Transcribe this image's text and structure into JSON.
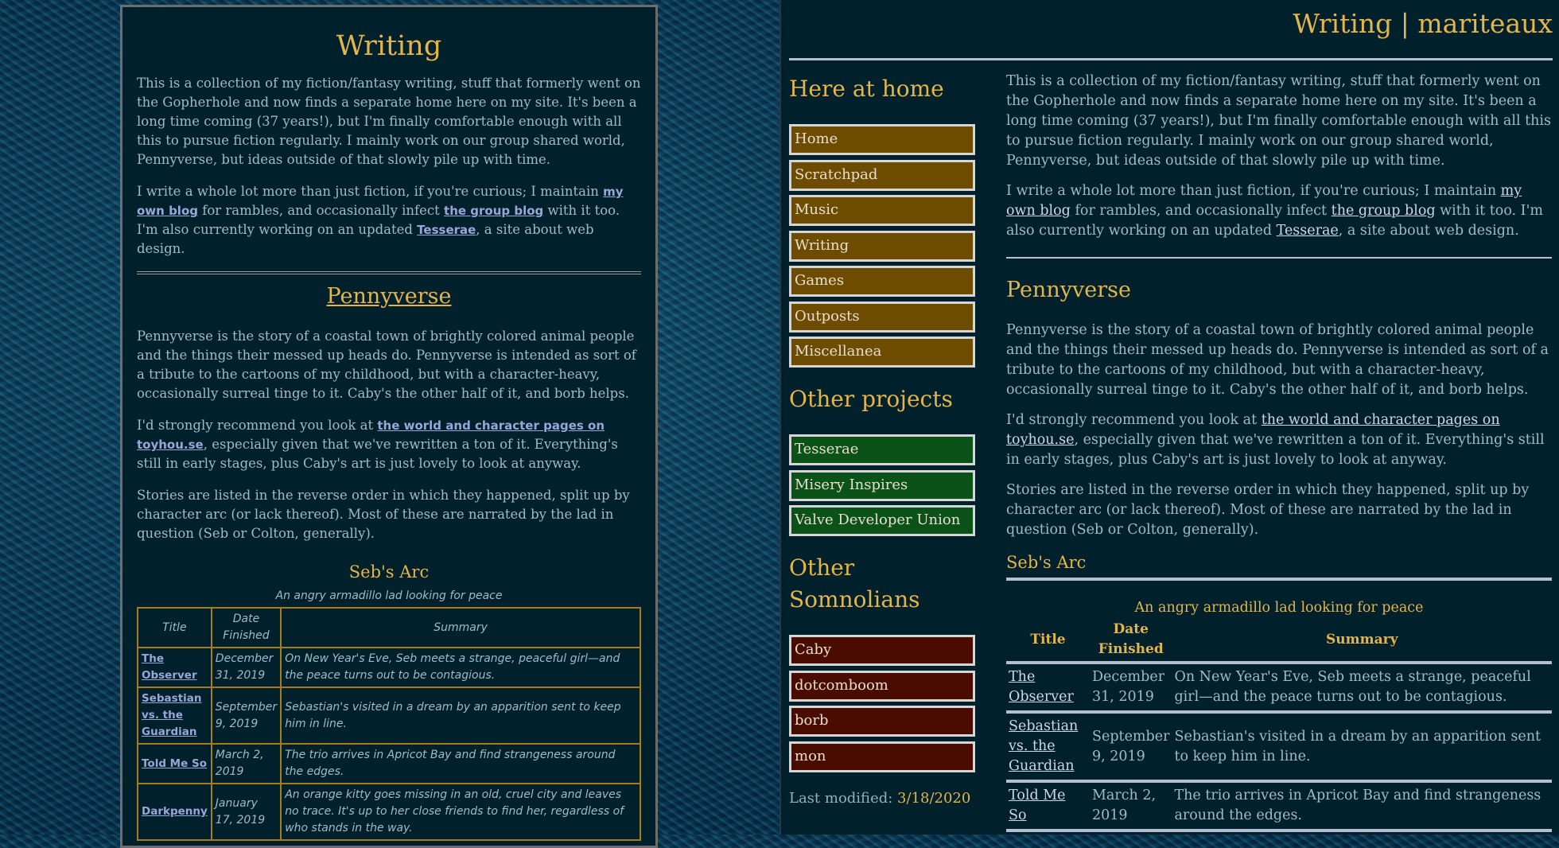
{
  "left": {
    "title": "Writing",
    "intro_p1": "This is a collection of my fiction/fantasy writing, stuff that formerly went on the Gopherhole and now finds a separate home here on my site. It's been a long time coming (37 years!), but I'm finally comfortable enough with all this to pursue fiction regularly. I mainly work on our group shared world, Pennyverse, but ideas outside of that slowly pile up with time.",
    "intro_p2_a": "I write a whole lot more than just fiction, if you're curious; I maintain ",
    "link_blog": "my own blog",
    "intro_p2_b": " for rambles, and occasionally infect ",
    "link_group_blog": "the group blog",
    "intro_p2_c": " with it too. I'm also currently working on an updated ",
    "link_tesserae": "Tesserae",
    "intro_p2_d": ", a site about web design.",
    "section_heading": "Pennyverse",
    "penny_p1": "Pennyverse is the story of a coastal town of brightly colored animal people and the things their messed up heads do. Pennyverse is intended as sort of a tribute to the cartoons of my childhood, but with a character-heavy, occasionally surreal tinge to it. Caby's the other half of it, and borb helps.",
    "penny_p2_a": "I'd strongly recommend you look at ",
    "link_toyhouse": "the world and character pages on toyhou.se",
    "penny_p2_b": ", especially given that we've rewritten a ton of it. Everything's still in early stages, plus Caby's art is just lovely to look at anyway.",
    "penny_p3": "Stories are listed in the reverse order in which they happened, split up by character arc (or lack thereof). Most of these are narrated by the lad in question (Seb or Colton, generally).",
    "arc_heading": "Seb's Arc",
    "arc_caption": "An angry armadillo lad looking for peace"
  },
  "table": {
    "headers": {
      "title": "Title",
      "date": "Date Finished",
      "summary": "Summary"
    },
    "rows": [
      {
        "title": "The Observer",
        "date": "December 31, 2019",
        "summary": "On New Year's Eve, Seb meets a strange, peaceful girl—and the peace turns out to be contagious."
      },
      {
        "title": "Sebastian vs. the Guardian",
        "date": "September 9, 2019",
        "summary": "Sebastian's visited in a dream by an apparition sent to keep him in line."
      },
      {
        "title": "Told Me So",
        "date": "March 2, 2019",
        "summary": "The trio arrives in Apricot Bay and find strangeness around the edges."
      },
      {
        "title": "Darkpenny",
        "date": "January 17, 2019",
        "summary": "An orange kitty goes missing in an old, cruel city and leaves no trace. It's up to her close friends to find her, regardless of who stands in the way."
      }
    ]
  },
  "right": {
    "site_title": "Writing | mariteaux",
    "sidebar": {
      "home_heading": "Here at home",
      "home_items": [
        "Home",
        "Scratchpad",
        "Music",
        "Writing",
        "Games",
        "Outposts",
        "Miscellanea"
      ],
      "projects_heading": "Other projects",
      "project_items": [
        "Tesserae",
        "Misery Inspires",
        "Valve Developer Union"
      ],
      "somnolians_heading": "Other Somnolians",
      "somnolian_items": [
        "Caby",
        "dotcomboom",
        "borb",
        "mon"
      ],
      "last_modified_label": "Last modified: ",
      "last_modified_date": "3/18/2020"
    }
  },
  "colors": {
    "accent": "#e3b54a",
    "panel_bg": "#00202c",
    "nav_home": "#6d4c00",
    "nav_projects": "#0b5219",
    "nav_somnolians": "#4a0b00"
  }
}
